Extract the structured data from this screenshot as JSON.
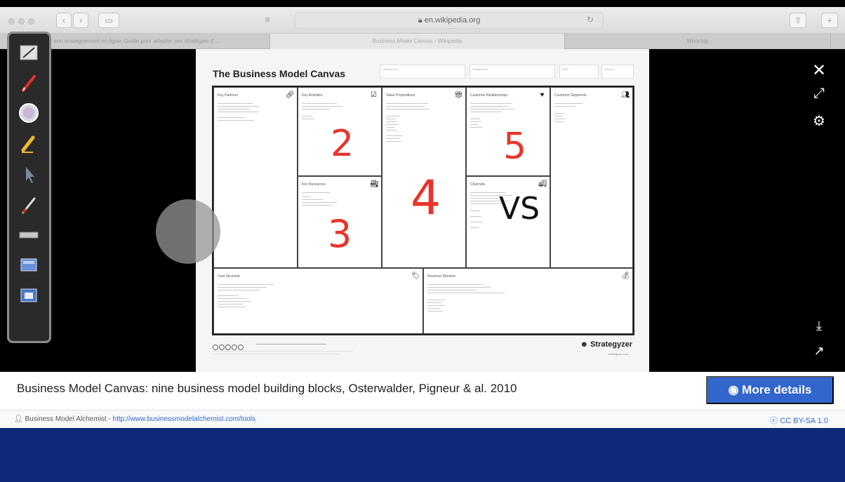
{
  "browser": {
    "url": "en.wikipedia.org",
    "tabs": [
      "r son enseignement en ligne: Guide pour adapter ses stratégies d'...",
      "Business Model Canvas - Wikipedia",
      "Wooclap"
    ]
  },
  "canvas": {
    "title": "The Business Model Canvas",
    "meta_fields": [
      "Designed for:",
      "Designed by:",
      "Date:",
      "Version:"
    ],
    "blocks": {
      "key_partners": "Key Partners",
      "key_activities": "Key Activities",
      "key_resources": "Key Resources",
      "value_propositions": "Value Propositions",
      "customer_relationships": "Customer Relationships",
      "channels": "Channels",
      "customer_segments": "Customer Segments",
      "cost_structure": "Cost Structure",
      "revenue_streams": "Revenue Streams"
    },
    "handwriting": {
      "key_activities": "2",
      "key_resources": "3",
      "value_propositions": "4",
      "customer_relationships": "5",
      "channels": "VS"
    },
    "brand": "Strategyzer",
    "brand_url": "strategyzer.com"
  },
  "viewer_controls": {
    "close_glyph": "✕",
    "expand_glyph": "⤢",
    "settings_glyph": "⚙",
    "download_glyph": "⤓",
    "share_glyph": "↗"
  },
  "caption": {
    "text": "Business Model Canvas: nine business model building blocks, Osterwalder, Pigneur & al. 2010",
    "more_details": "More details"
  },
  "attribution": {
    "author": "Business Model Alchemist - ",
    "link": "http://www.businessmodelalchemist.com/tools",
    "license": "CC BY-SA 1.0"
  },
  "colors": {
    "accent_blue": "#3366cc",
    "handwriting_red": "#e8352b",
    "background_blue": "#0e2a78"
  }
}
